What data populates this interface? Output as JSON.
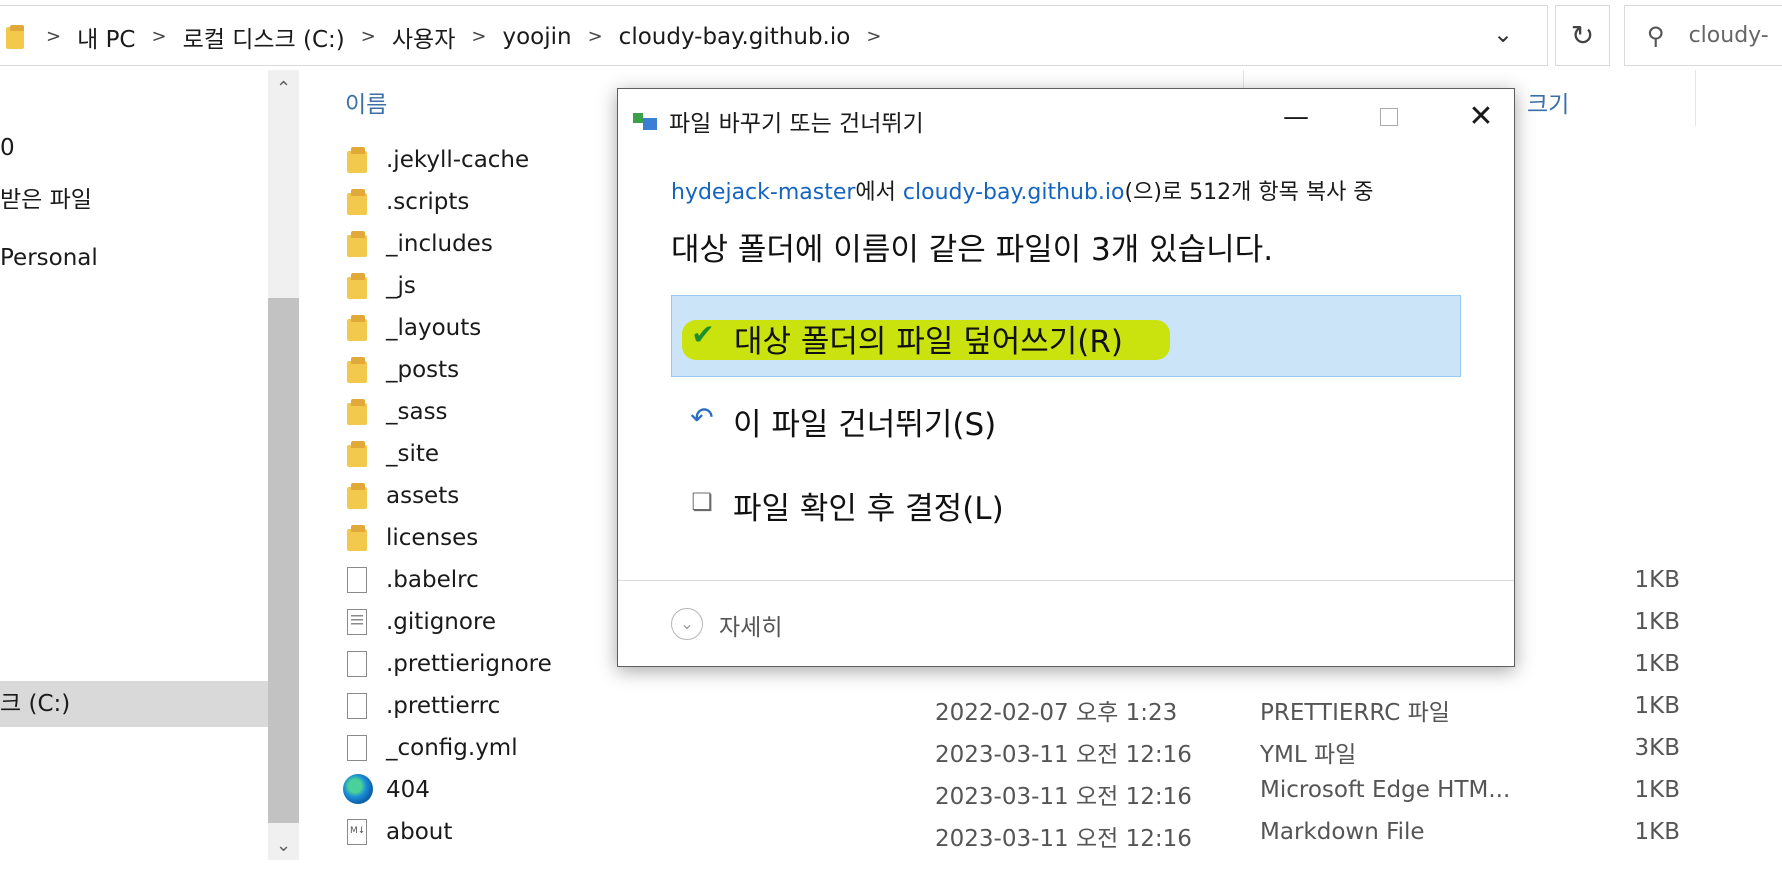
{
  "address": {
    "crumbs": [
      "내 PC",
      "로컬 디스크 (C:)",
      "사용자",
      "yoojin",
      "cloudy-bay.github.io"
    ],
    "search_text": "cloudy-"
  },
  "nav": {
    "items": [
      {
        "label": "0"
      },
      {
        "label": "받은 파일"
      },
      {
        "label": " Personal"
      },
      {
        "label": "크 (C:)"
      }
    ]
  },
  "columns": {
    "name": "이름",
    "size": "크기"
  },
  "files": [
    {
      "icon": "folder-icon",
      "name": ".jekyll-cache",
      "date": "",
      "type": "",
      "size": ""
    },
    {
      "icon": "folder-icon",
      "name": ".scripts",
      "date": "",
      "type": "",
      "size": ""
    },
    {
      "icon": "folder-icon",
      "name": "_includes",
      "date": "",
      "type": "",
      "size": ""
    },
    {
      "icon": "folder-icon",
      "name": "_js",
      "date": "",
      "type": "",
      "size": ""
    },
    {
      "icon": "folder-icon",
      "name": "_layouts",
      "date": "",
      "type": "",
      "size": ""
    },
    {
      "icon": "folder-icon",
      "name": "_posts",
      "date": "",
      "type": "",
      "size": ""
    },
    {
      "icon": "folder-icon",
      "name": "_sass",
      "date": "",
      "type": "",
      "size": ""
    },
    {
      "icon": "folder-icon",
      "name": "_site",
      "date": "",
      "type": "",
      "size": ""
    },
    {
      "icon": "folder-icon",
      "name": "assets",
      "date": "",
      "type": "",
      "size": ""
    },
    {
      "icon": "folder-icon",
      "name": "licenses",
      "date": "",
      "type": "",
      "size": ""
    },
    {
      "icon": "file-icon",
      "name": ".babelrc",
      "date": "",
      "type": "",
      "size": "1KB"
    },
    {
      "icon": "text-file-icon",
      "name": ".gitignore",
      "date": "",
      "type": "",
      "size": "1KB"
    },
    {
      "icon": "file-icon",
      "name": ".prettierignore",
      "date": "",
      "type": "",
      "size": "1KB"
    },
    {
      "icon": "file-icon",
      "name": ".prettierrc",
      "date": "2022-02-07 오후 1:23",
      "type": "PRETTIERRC 파일",
      "size": "1KB"
    },
    {
      "icon": "file-icon",
      "name": "_config.yml",
      "date": "2023-03-11 오전 12:16",
      "type": "YML 파일",
      "size": "3KB"
    },
    {
      "icon": "edge-icon",
      "name": "404",
      "date": "2023-03-11 오전 12:16",
      "type": "Microsoft Edge HTM...",
      "size": "1KB"
    },
    {
      "icon": "markdown-icon",
      "name": "about",
      "date": "2023-03-11 오전 12:16",
      "type": "Markdown File",
      "size": "1KB"
    }
  ],
  "dialog": {
    "title": "파일 바꾸기 또는 건너뛰기",
    "source": "hydejack-master",
    "text_from": "에서 ",
    "dest": "cloudy-bay.github.io",
    "text_rest": "(으)로 512개 항목 복사 중",
    "heading": "대상 폴더에 이름이 같은 파일이 3개 있습니다.",
    "options": [
      {
        "icon": "checkmark-icon",
        "label": "대상 폴더의 파일 덮어쓰기(R)"
      },
      {
        "icon": "skip-icon",
        "label": "이 파일 건너뛰기(S)"
      },
      {
        "icon": "compare-files-icon",
        "label": "파일 확인 후 결정(L)"
      }
    ],
    "more_details": "자세히"
  },
  "colors": {
    "link": "#1565c0",
    "selected_option": "#cce4f7",
    "highlight": "#c9e200",
    "column_header": "#3a6fa8"
  }
}
